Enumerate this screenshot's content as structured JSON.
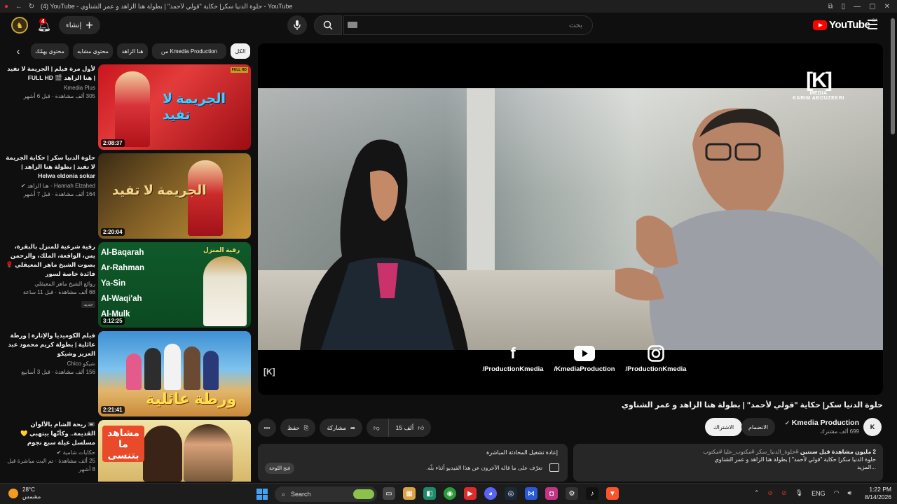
{
  "browser": {
    "tab_title": "(4) YouTube - حلوة الدنيا سكر| حكاية \"قولي لأحمد\" | بطولة هنا الزاهد و عمر الشناوي - YouTube"
  },
  "header": {
    "notifications_count": "4",
    "create_label": "إنشاء",
    "search_placeholder": "بحث",
    "logo_text": "YouTube",
    "logo_region": "SA"
  },
  "chips": [
    {
      "label": "الكل",
      "active": true
    },
    {
      "label": "من Kmedia Production",
      "active": false
    },
    {
      "label": "هنا الزاهد",
      "active": false
    },
    {
      "label": "محتوى مشابه",
      "active": false
    },
    {
      "label": "محتوى يهمّك",
      "active": false
    }
  ],
  "recommendations": [
    {
      "title": "لأول مرة فيلم | الجريمة لا تفيد | هنا الزاهد 🎬 FULL HD",
      "channel": "Kmedia Plus",
      "meta": "305 ألف مشاهدة · قبل 6 أشهر",
      "duration": "2:08:37",
      "thumb_text": "الجريمة لا تفيد",
      "badge": "FULL HD"
    },
    {
      "title": "حلوة الدنيا سكر | حكاية الجريمة لا تفيد | بطولة هنا الزاهد | Helwa eldonia sokar",
      "channel": "Hannah Elzahed - هنا الزاهد ✔",
      "meta": "164 ألف مشاهدة · قبل 7 أشهر",
      "duration": "2:20:04",
      "thumb_text": "الجريمة لا تفيد"
    },
    {
      "title": "رقية شرعية للمنزل بالبقرة، يس، الواقعة، الملك، والرحمن بصوت الشيخ ماهر المعيقلي 🌹 فائدة خاصة لسور",
      "channel": "روائع الشيخ ماهر المعيقلي",
      "meta": "68 ألف مشاهدة · قبل 11 ساعة",
      "duration": "3:12:25",
      "new_tag": "جديد",
      "thumb_lines": [
        "Al-Baqarah",
        "Ar-Rahman",
        "Ya-Sin",
        "Al-Waqi'ah",
        "Al-Mulk"
      ],
      "thumb_text": "رقية المنزل"
    },
    {
      "title": "فيلم الكوميديا والإثارة | ورطة عائلية | بطولة كريم محمود عبد العزيز وشيكو",
      "channel": "شيكو Chico",
      "meta": "156 ألف مشاهدة · قبل 3 أسابيع",
      "duration": "2:21:41",
      "thumb_text": "ورطة عائلية"
    },
    {
      "title": "📼 ريحة الشام بالألوان القديمة.. وكأنّها بيتهبي 💛 مسلسل عيلة سبع نجوم",
      "channel": "حكايات شامية ✔",
      "meta": "25 ألف مشاهدة · تم البث مباشرة قبل 8 أشهر",
      "duration": "",
      "thumb_text": "مشاهد ما بتنسى"
    }
  ],
  "player": {
    "watermark_brand": "MEDIA",
    "watermark_name": "KARIM ABOUZEKRI",
    "socials": [
      {
        "icon": "facebook-icon",
        "label": "/ProductionKmedia"
      },
      {
        "icon": "youtube-icon",
        "label": "/KmediaProduction"
      },
      {
        "icon": "instagram-icon",
        "label": "/ProductionKmedia"
      }
    ]
  },
  "video": {
    "title": "حلوة الدنيا سكر| حكاية \"قولي لأحمد\" | بطولة هنا الزاهد و عمر الشناوي",
    "likes": "15 ألف",
    "share_label": "مشاركة",
    "save_label": "حفظ"
  },
  "channel": {
    "name": "Kmedia Production",
    "subscribers": "699 ألف مشترك",
    "join_label": "الانضمام",
    "subscribe_label": "الاشتراك"
  },
  "description": {
    "views_line": "2 مليون مشاهدة  قبل سنتين",
    "tags": "#حلوة_الدنيا_سكر #مكتوب_عليا #مكتوب",
    "text": "حلوة الدنيا سكر| حكاية \"قولي لأحمد\" | بطولة هنا الزاهد و عمر الشناوي",
    "more": "...المزيد"
  },
  "chat": {
    "title": "إعادة تشغيل المحادثة المباشرة",
    "subtitle": "تعرّف على ما قاله الآخرون عن هذا الفيديو أثناء بثّه.",
    "button": "فتح اللوحة"
  },
  "taskbar": {
    "temp": "28°C",
    "weather": "مشمس",
    "search_label": "Search",
    "lang": "ENG",
    "time": "1:22 PM",
    "date": "8/14/2026"
  },
  "colors": {
    "background": "#0f0f0f",
    "surface": "#272727",
    "accent_red": "#ff0000",
    "text": "#f1f1f1",
    "muted": "#aaaaaa"
  }
}
